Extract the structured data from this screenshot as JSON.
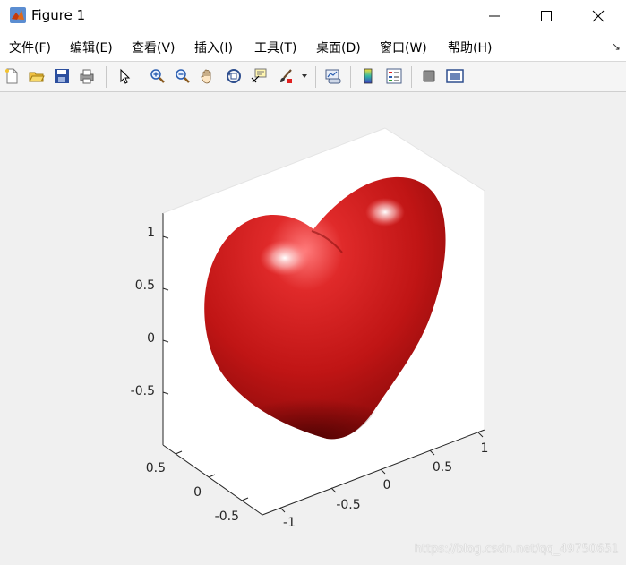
{
  "window": {
    "title": "Figure 1",
    "controls": [
      "minimize-icon",
      "maximize-icon",
      "close-icon"
    ]
  },
  "menubar": {
    "items": [
      {
        "label": "文件(F)"
      },
      {
        "label": "编辑(E)"
      },
      {
        "label": "查看(V)"
      },
      {
        "label": "插入(I)"
      },
      {
        "label": "工具(T)"
      },
      {
        "label": "桌面(D)"
      },
      {
        "label": "窗口(W)"
      },
      {
        "label": "帮助(H)"
      }
    ]
  },
  "toolbar": {
    "tools": [
      "new-figure-icon",
      "open-icon",
      "save-icon",
      "print-icon",
      "select-arrow-icon",
      "zoom-in-icon",
      "zoom-out-icon",
      "pan-hand-icon",
      "rotate-3d-icon",
      "data-cursor-icon",
      "brush-icon",
      "brush-dropdown-icon",
      "link-plot-icon",
      "colorbar-icon",
      "legend-icon",
      "hide-plot-tools-icon",
      "show-plot-tools-icon"
    ]
  },
  "axes": {
    "z_ticks": [
      "1",
      "0.5",
      "0",
      "-0.5"
    ],
    "y_ticks": [
      "0.5",
      "0",
      "-0.5"
    ],
    "x_ticks": [
      "-1",
      "-0.5",
      "0",
      "0.5",
      "1"
    ],
    "surface_color": "#c8161a"
  },
  "watermark": "https://blog.csdn.net/qq_49750651"
}
